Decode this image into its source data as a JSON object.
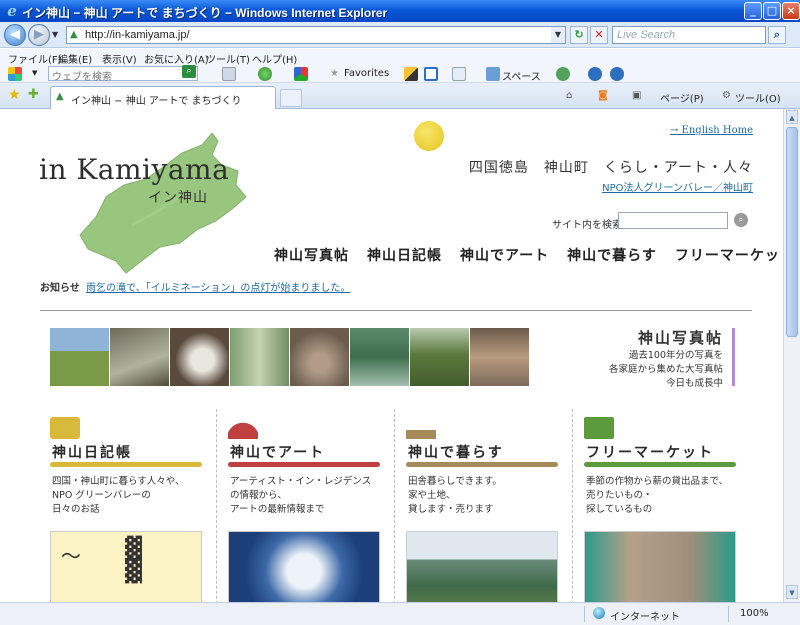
{
  "window": {
    "title": "イン神山 − 神山 アートで まちづくり − Windows Internet Explorer",
    "controls": [
      "_",
      "□",
      "×"
    ]
  },
  "address_bar": {
    "url": "http://in-kamiyama.jp/",
    "search_placeholder": "Live Search"
  },
  "menu": [
    "ファイル(F)",
    "編集(E)",
    "表示(V)",
    "お気に入り(A)",
    "ツール(T)",
    "ヘルプ(H)"
  ],
  "links_bar": {
    "search_placeholder": "ウェブを検索",
    "favorites_label": "Favorites",
    "space_label": "スペース"
  },
  "tabs": [
    {
      "label": "イン神山 − 神山 アートで まちづくり",
      "active": true
    }
  ],
  "command_bar": {
    "page_label": "ページ(P)",
    "tools_label": "ツール(O)"
  },
  "page": {
    "logo_text": "in Kamiyama",
    "logo_sub": "イン神山",
    "english_link": "→ English Home",
    "tagline": "四国徳島　神山町　くらし・アート・人々",
    "npo_link": "NPO法人グリーンバレー／神山町",
    "site_search_label": "サイト内を検索",
    "global_nav": [
      "神山写真帖",
      "神山日記帳",
      "神山でアート",
      "神山で暮らす",
      "フリーマーケット"
    ],
    "notice_label": "お知らせ",
    "notice_text": "雨乞の滝で、「イルミネーション」の点灯が始まりました。",
    "photo_panel": {
      "title": "神山写真帖",
      "desc_lines": [
        "過去100年分の写真を",
        "各家庭から集めた大写真帖",
        "今日も成長中"
      ]
    },
    "columns": [
      {
        "id": "diary",
        "title": "神山日記帳",
        "desc": "四国・神山町に暮らす人々や、\nNPO グリーンバレーの\n日々のお話",
        "color": "#d8b93a"
      },
      {
        "id": "art",
        "title": "神山でアート",
        "desc": "アーティスト・イン・レジデンス\nの情報から、\nアートの最新情報まで",
        "color": "#c0403f"
      },
      {
        "id": "live",
        "title": "神山で暮らす",
        "desc": "田舎暮らしできます。\n家や土地、\n貸します・売ります",
        "color": "#a58a5a"
      },
      {
        "id": "market",
        "title": "フリーマーケット",
        "desc": "季節の作物から薪の貸出品まで、\n売りたいもの・\n探しているもの",
        "color": "#5c9a3e"
      }
    ]
  },
  "status_bar": {
    "zone": "インターネット",
    "zoom": "100%"
  }
}
